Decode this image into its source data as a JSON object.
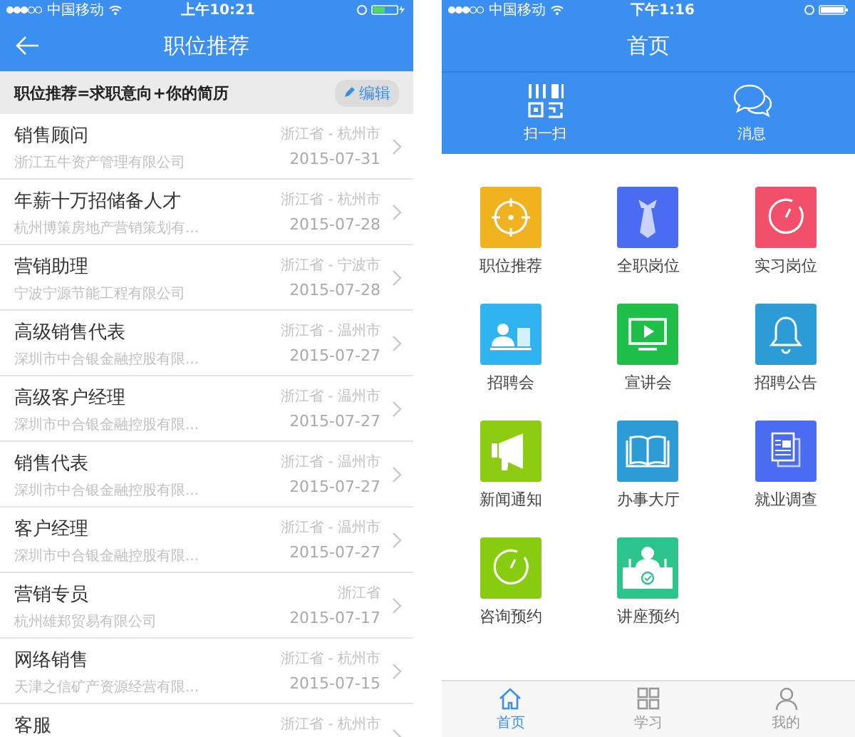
{
  "left": {
    "status": {
      "carrier": "中国移动",
      "time": "上午10:21"
    },
    "title": "职位推荐",
    "banner": {
      "text": "职位推荐=求职意向+你的简历",
      "edit": "编辑"
    },
    "jobs": [
      {
        "title": "销售顾问",
        "company": "浙江五牛资产管理有限公司",
        "location": "浙江省 - 杭州市",
        "date": "2015-07-31"
      },
      {
        "title": "年薪十万招储备人才",
        "company": "杭州博策房地产营销策划有...",
        "location": "浙江省 - 杭州市",
        "date": "2015-07-28"
      },
      {
        "title": "营销助理",
        "company": "宁波宁源节能工程有限公司",
        "location": "浙江省 - 宁波市",
        "date": "2015-07-28"
      },
      {
        "title": "高级销售代表",
        "company": "深圳市中合银金融控股有限...",
        "location": "浙江省 - 温州市",
        "date": "2015-07-27"
      },
      {
        "title": "高级客户经理",
        "company": "深圳市中合银金融控股有限...",
        "location": "浙江省 - 温州市",
        "date": "2015-07-27"
      },
      {
        "title": "销售代表",
        "company": "深圳市中合银金融控股有限...",
        "location": "浙江省 - 温州市",
        "date": "2015-07-27"
      },
      {
        "title": "客户经理",
        "company": "深圳市中合银金融控股有限...",
        "location": "浙江省 - 温州市",
        "date": "2015-07-27"
      },
      {
        "title": "营销专员",
        "company": "杭州雄郑贸易有限公司",
        "location": "浙江省",
        "date": "2015-07-17"
      },
      {
        "title": "网络销售",
        "company": "天津之信矿产资源经营有限...",
        "location": "浙江省 - 杭州市",
        "date": "2015-07-15"
      },
      {
        "title": "客服",
        "location": "浙江省 - 杭州市"
      }
    ]
  },
  "right": {
    "status": {
      "carrier": "中国移动",
      "time": "下午1:16"
    },
    "title": "首页",
    "shortcuts": [
      {
        "label": "扫一扫",
        "kind": "scan"
      },
      {
        "label": "消息",
        "kind": "chat"
      }
    ],
    "tiles": [
      {
        "label": "职位推荐",
        "kind": "target",
        "color": "#f0b21e"
      },
      {
        "label": "全职岗位",
        "kind": "tie",
        "color": "#4a6cf0"
      },
      {
        "label": "实习岗位",
        "kind": "clock",
        "color": "#f2506a"
      },
      {
        "label": "招聘会",
        "kind": "person",
        "color": "#2fb4f0"
      },
      {
        "label": "宣讲会",
        "kind": "video",
        "color": "#1fbf4a"
      },
      {
        "label": "招聘公告",
        "kind": "bell",
        "color": "#2c9bd6"
      },
      {
        "label": "新闻通知",
        "kind": "megaphone",
        "color": "#8ccc12"
      },
      {
        "label": "办事大厅",
        "kind": "book",
        "color": "#2c9bd6"
      },
      {
        "label": "就业调查",
        "kind": "document",
        "color": "#4a6cf0"
      },
      {
        "label": "咨询预约",
        "kind": "clock",
        "color": "#88cc10"
      },
      {
        "label": "讲座预约",
        "kind": "lecture",
        "color": "#2cc48a"
      }
    ],
    "tabs": [
      {
        "label": "首页",
        "kind": "home",
        "selected": true
      },
      {
        "label": "学习",
        "kind": "grid",
        "selected": false
      },
      {
        "label": "我的",
        "kind": "person",
        "selected": false
      }
    ]
  }
}
